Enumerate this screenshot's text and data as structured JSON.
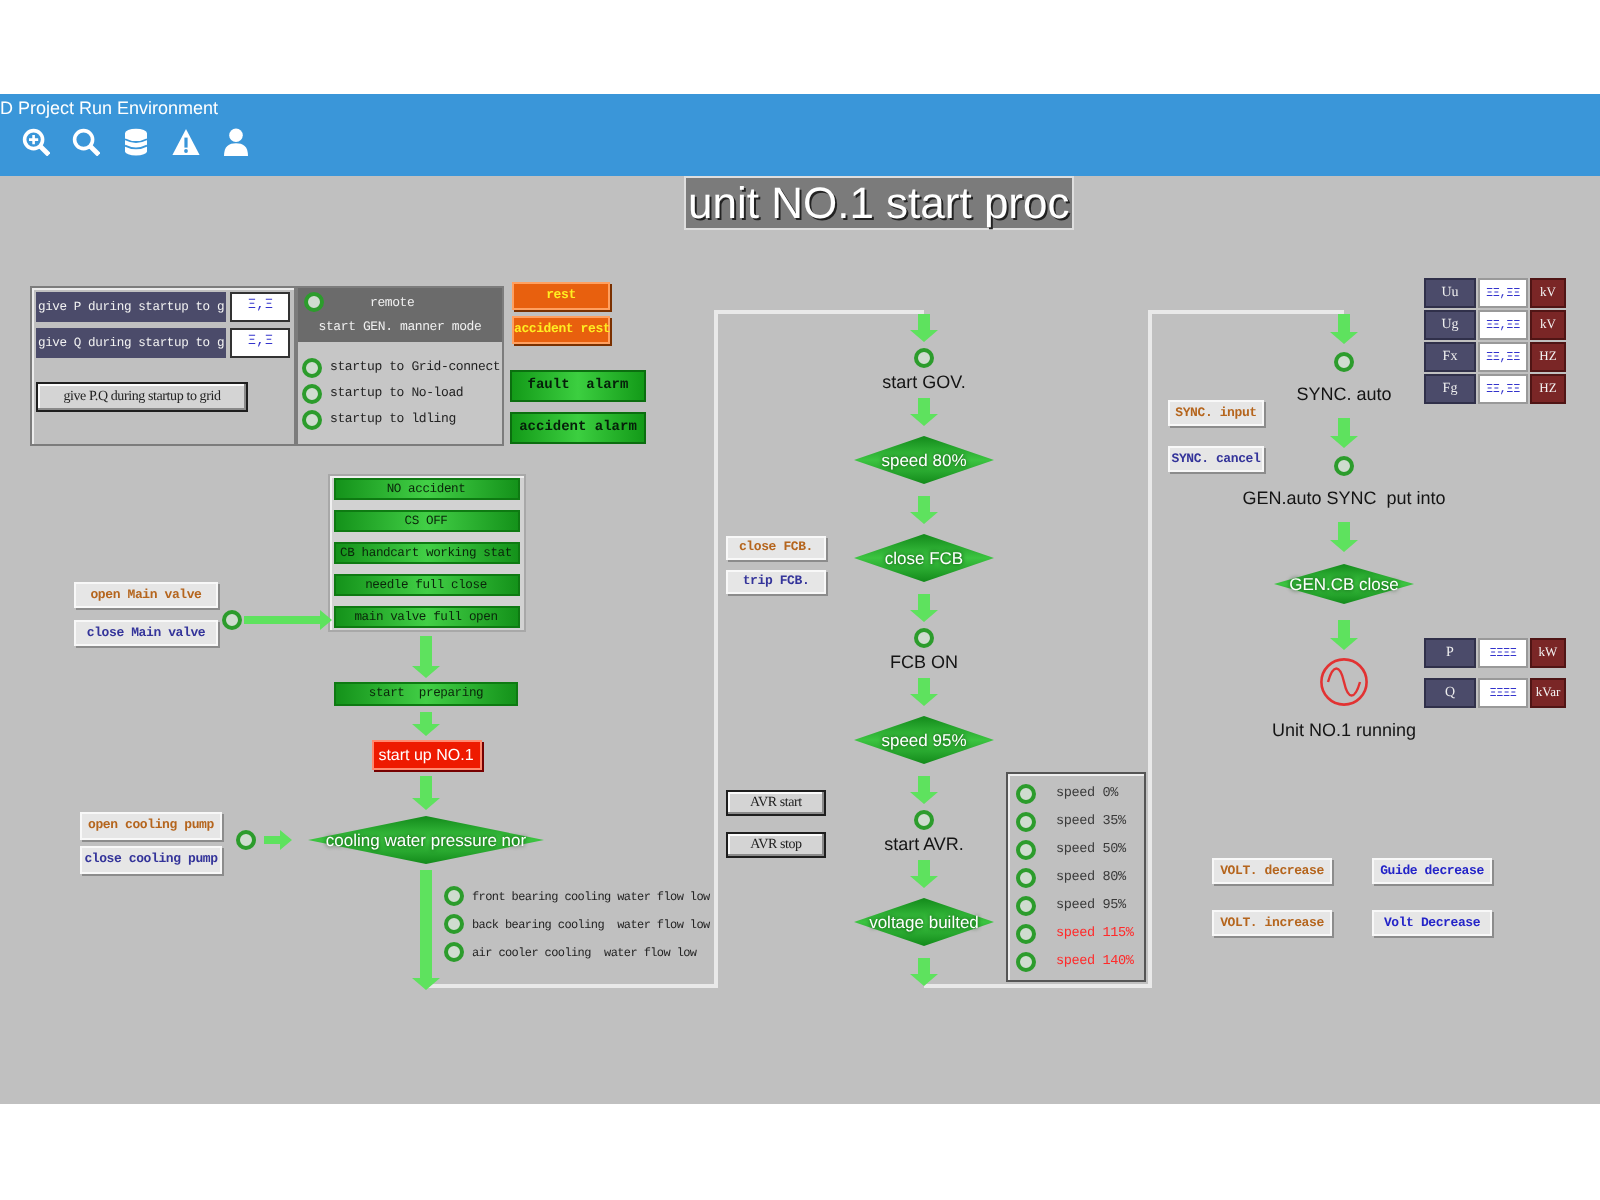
{
  "window": {
    "title": "D Project Run Environment"
  },
  "page_title": "unit NO.1 start proc",
  "setpoint_panel": {
    "rows": [
      {
        "label": "give P during startup to g",
        "value": "Ξ,Ξ"
      },
      {
        "label": "give Q during startup to g",
        "value": "Ξ,Ξ"
      }
    ],
    "button": "give P.Q during startup to grid"
  },
  "mode_panel": {
    "remote": "remote",
    "title": "start GEN. manner mode",
    "options": [
      {
        "label": "startup to Grid-connect",
        "selected": false
      },
      {
        "label": "startup to No-load",
        "selected": false
      },
      {
        "label": "startup to ldling",
        "selected": false
      }
    ]
  },
  "reset_buttons": [
    "rest",
    "accident rest"
  ],
  "alarms": [
    "fault  alarm",
    "accident alarm"
  ],
  "permissives": [
    "NO accident",
    "CS OFF",
    "CB handcart working stat",
    "needle full close",
    "main valve full open"
  ],
  "main_valve_buttons": [
    {
      "label": "open Main valve",
      "color": "#b5651d"
    },
    {
      "label": "close Main valve",
      "color": "#34349a"
    }
  ],
  "preparing": "start  preparing",
  "start_button": "start up NO.1",
  "cooling_pump_buttons": [
    {
      "label": "open cooling pump",
      "color": "#b5651d"
    },
    {
      "label": "close cooling pump",
      "color": "#34349a"
    }
  ],
  "cooling_check": "cooling water pressure nor",
  "cooling_alarms": [
    "front bearing cooling water flow low",
    "back bearing cooling  water flow low",
    "air cooler cooling  water flow low"
  ],
  "governor_sequence": [
    {
      "kind": "lamp",
      "label": "start GOV."
    },
    {
      "kind": "check",
      "label": "speed 80%"
    },
    {
      "kind": "check",
      "label": "close FCB"
    },
    {
      "kind": "lamp",
      "label": "FCB ON"
    },
    {
      "kind": "check",
      "label": "speed 95%"
    },
    {
      "kind": "lamp",
      "label": "start AVR."
    },
    {
      "kind": "check",
      "label": "voltage builted"
    }
  ],
  "fcb_buttons": [
    {
      "label": "close FCB.",
      "color": "#b5651d"
    },
    {
      "label": "trip FCB.",
      "color": "#34349a"
    }
  ],
  "avr_buttons": [
    "AVR start",
    "AVR stop"
  ],
  "speed_relays": [
    {
      "label": "speed 0%",
      "color": "#3a3a3a"
    },
    {
      "label": "speed 35%",
      "color": "#3a3a3a"
    },
    {
      "label": "speed 50%",
      "color": "#3a3a3a"
    },
    {
      "label": "speed 80%",
      "color": "#3a3a3a"
    },
    {
      "label": "speed 95%",
      "color": "#3a3a3a"
    },
    {
      "label": "speed 115%",
      "color": "#ff2a2a"
    },
    {
      "label": "speed 140%",
      "color": "#ff2a2a"
    }
  ],
  "sync_sequence": [
    {
      "kind": "lamp",
      "label": "SYNC. auto"
    },
    {
      "kind": "lamp",
      "label": "GEN.auto SYNC  put into"
    },
    {
      "kind": "check",
      "label": "GEN.CB close"
    },
    {
      "kind": "generator",
      "label": "Unit NO.1 running"
    }
  ],
  "sync_buttons": [
    {
      "label": "SYNC. input",
      "color": "#b5651d"
    },
    {
      "label": "SYNC. cancel",
      "color": "#34349a"
    }
  ],
  "grid_readings": [
    {
      "label": "Uu",
      "value": "ΞΞ,ΞΞ",
      "unit": "kV"
    },
    {
      "label": "Ug",
      "value": "ΞΞ,ΞΞ",
      "unit": "kV"
    },
    {
      "label": "Fx",
      "value": "ΞΞ,ΞΞ",
      "unit": "HZ"
    },
    {
      "label": "Fg",
      "value": "ΞΞ,ΞΞ",
      "unit": "HZ"
    }
  ],
  "power_readings": [
    {
      "label": "P",
      "value": "ΞΞΞΞ",
      "unit": "kW"
    },
    {
      "label": "Q",
      "value": "ΞΞΞΞ",
      "unit": "kVar"
    }
  ],
  "excitation_buttons": [
    {
      "label": "VOLT. decrease",
      "color": "#b5651d"
    },
    {
      "label": "Guide decrease",
      "color": "#2424c8"
    },
    {
      "label": "VOLT. increase",
      "color": "#b5651d"
    },
    {
      "label": "Volt Decrease",
      "color": "#2424c8"
    }
  ]
}
